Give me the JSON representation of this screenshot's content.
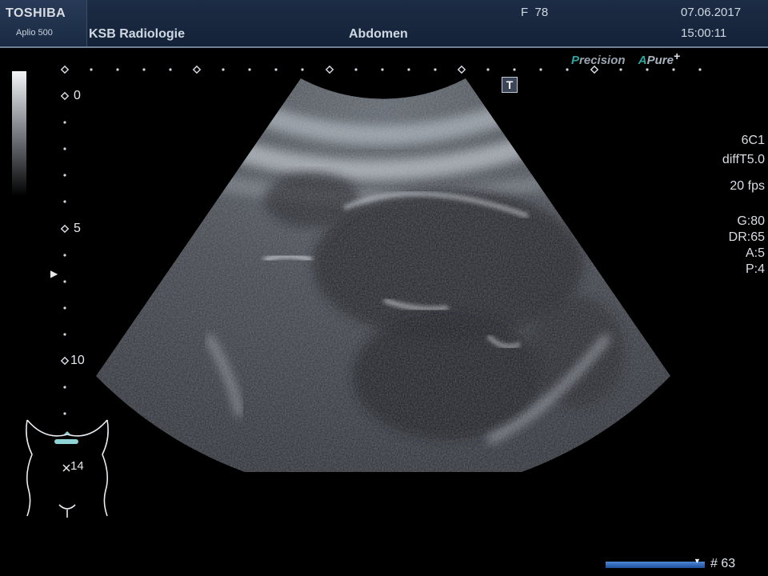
{
  "header": {
    "brand": "TOSHIBA",
    "model": "Aplio 500",
    "institution": "KSB Radiologie",
    "exam": "Abdomen",
    "frequency": "F  78",
    "date": "07.06.2017",
    "time": "15:00:11"
  },
  "logos": {
    "precision_first": "P",
    "precision_rest": "recision",
    "apure_first": "A",
    "apure_rest": "Pure",
    "apure_plus": "+"
  },
  "params": {
    "probe": "6C1",
    "preset": "diffT5.0",
    "frame_rate": "20 fps",
    "gain": "G:80",
    "dynamic_range": "DR:65",
    "a": "A:5",
    "p": "P:4"
  },
  "depth_scale": {
    "labels": [
      "0",
      "5",
      "10"
    ]
  },
  "t_marker": "T",
  "focus_marker": "▶",
  "probe_position": "14",
  "frame_counter": "# 63",
  "colors": {
    "header_bg": "#1d2c45",
    "bodymark_probe": "#8fd3d6",
    "frame_bar": "#3a74c8"
  }
}
